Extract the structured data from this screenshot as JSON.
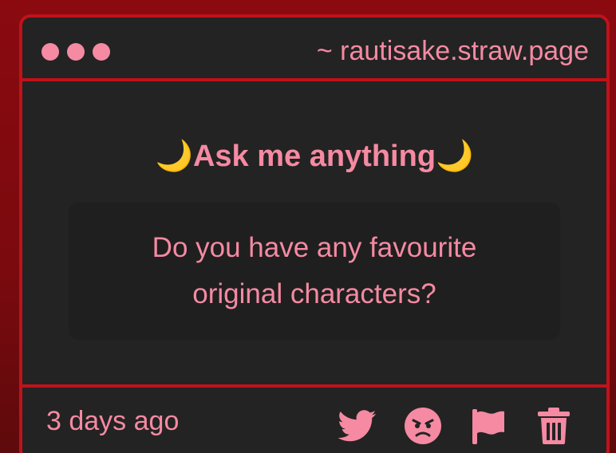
{
  "window": {
    "url": "~ rautisake.straw.page"
  },
  "main": {
    "heading": {
      "emoji_left": "🌙",
      "text": "Ask me anything",
      "emoji_right": "🌙"
    },
    "question": {
      "line1": "Do you have any favourite",
      "line2": "original characters?"
    }
  },
  "footer": {
    "timestamp": "3 days ago",
    "actions": [
      "twitter-icon",
      "angry-face-icon",
      "flag-icon",
      "trash-icon"
    ]
  },
  "colors": {
    "accent": "#f58aa2",
    "border": "#c0121a",
    "card_bg": "#232323",
    "moon": "#f6b41c"
  }
}
